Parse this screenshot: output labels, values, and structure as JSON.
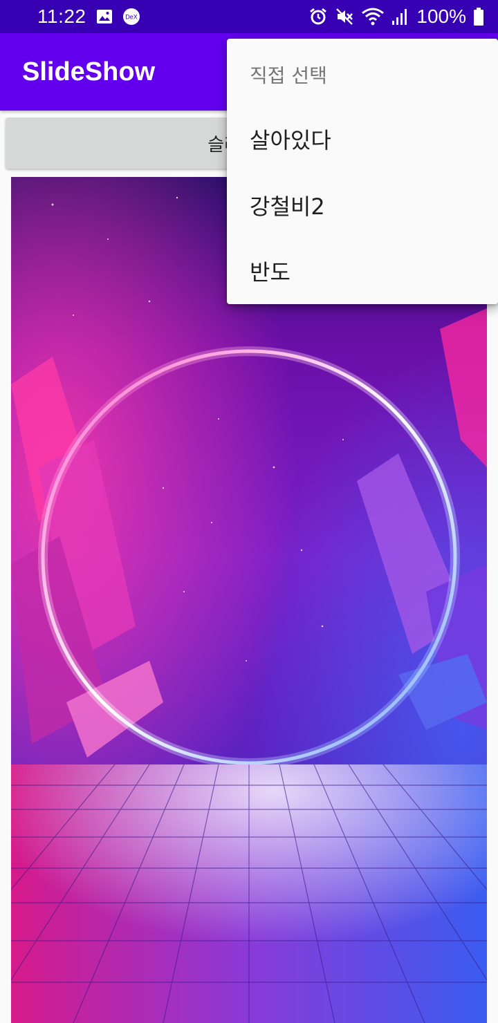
{
  "status_bar": {
    "time": "11:22",
    "battery": "100%",
    "left_icons": [
      "image-icon",
      "dex-icon"
    ],
    "right_icons": [
      "alarm-icon",
      "mute-icon",
      "wifi-icon",
      "signal-icon",
      "battery-icon"
    ],
    "dex_label": "DeX"
  },
  "app_bar": {
    "title": "SlideShow",
    "color": "#6200ee"
  },
  "slideshow_button": {
    "label": "슬라이드쇼"
  },
  "popup_menu": {
    "header": "직접 선택",
    "items": [
      {
        "label": "살아있다"
      },
      {
        "label": "강철비2"
      },
      {
        "label": "반도"
      }
    ]
  },
  "colors": {
    "status_bar": "#3700b3",
    "primary": "#6200ee",
    "button": "#d6d7d7"
  }
}
